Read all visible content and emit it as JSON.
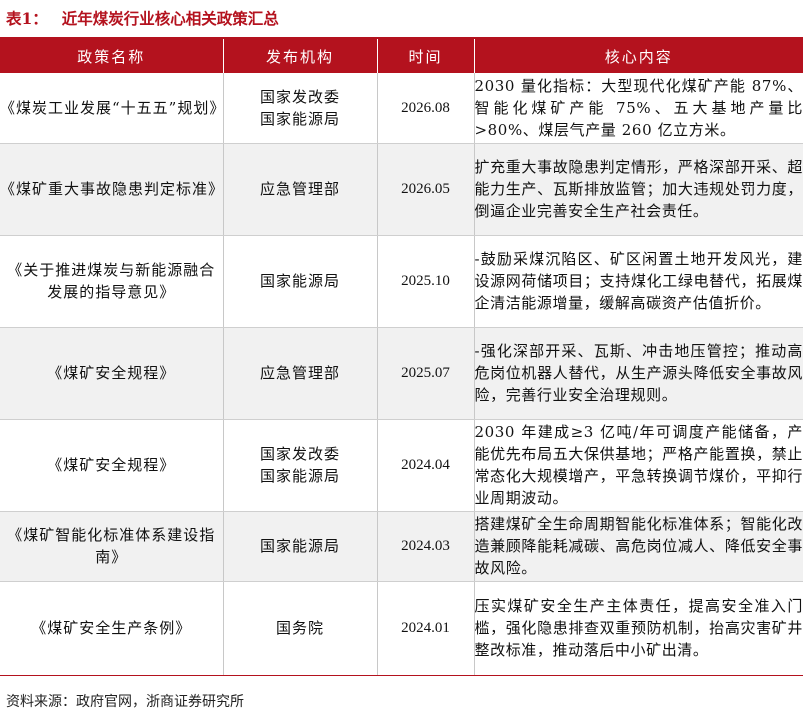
{
  "title": {
    "prefix": "表1：",
    "text": "近年煤炭行业核心相关政策汇总"
  },
  "columns": [
    "政策名称",
    "发布机构",
    "时间",
    "核心内容"
  ],
  "rows": [
    {
      "name": "《煤炭工业发展“十五五”规划》",
      "org": "国家发改委\n国家能源局",
      "date": "2026.08",
      "content": "2030 量化指标：大型现代化煤矿产能 87%、智能化煤矿产能 75%、五大基地产量比>80%、煤层气产量 260 亿立方米。"
    },
    {
      "name": "《煤矿重大事故隐患判定标准》",
      "org": "应急管理部",
      "date": "2026.05",
      "content": "扩充重大事故隐患判定情形，严格深部开采、超能力生产、瓦斯排放监管；加大违规处罚力度，倒逼企业完善安全生产社会责任。"
    },
    {
      "name": "《关于推进煤炭与新能源融合发展的指导意见》",
      "org": "国家能源局",
      "date": "2025.10",
      "content": "-鼓励采煤沉陷区、矿区闲置土地开发风光，建设源网荷储项目；支持煤化工绿电替代，拓展煤企清洁能源增量，缓解高碳资产估值折价。"
    },
    {
      "name": "《煤矿安全规程》",
      "org": "应急管理部",
      "date": "2025.07",
      "content": "-强化深部开采、瓦斯、冲击地压管控；推动高危岗位机器人替代，从生产源头降低安全事故风险，完善行业安全治理规则。"
    },
    {
      "name": "《煤矿安全规程》",
      "org": "国家发改委\n国家能源局",
      "date": "2024.04",
      "content": "2030 年建成≥3 亿吨/年可调度产能储备，产能优先布局五大保供基地；严格产能置换，禁止常态化大规模增产，平急转换调节煤价，平抑行业周期波动。"
    },
    {
      "name": "《煤矿智能化标准体系建设指南》",
      "org": "国家能源局",
      "date": "2024.03",
      "content": "搭建煤矿全生命周期智能化标准体系；智能化改造兼顾降能耗减碳、高危岗位减人、降低安全事故风险。"
    },
    {
      "name": "《煤矿安全生产条例》",
      "org": "国务院",
      "date": "2024.01",
      "content": "压实煤矿安全生产主体责任，提高安全准入门槛，强化隐患排查双重预防机制，抬高灾害矿井整改标准，推动落后中小矿出清。"
    }
  ],
  "source": "资料来源：政府官网，浙商证券研究所",
  "colors": {
    "accent": "#b4121e",
    "stripe": "#f1f1f1"
  }
}
